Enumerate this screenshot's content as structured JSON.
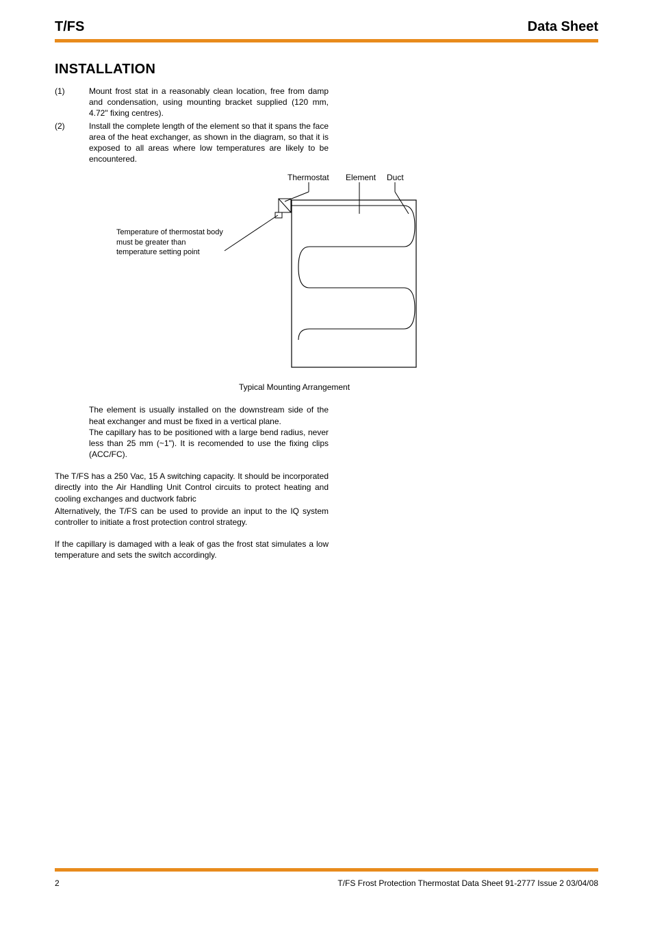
{
  "header": {
    "left": "T/FS",
    "right": "Data Sheet"
  },
  "section_heading": "INSTALLATION",
  "steps": [
    {
      "num": "(1)",
      "text": "Mount frost stat in a reasonably clean location, free from damp and condensation, using mounting bracket supplied (120 mm, 4.72\" fixing centres)."
    },
    {
      "num": "(2)",
      "text": "Install the complete length of the element so that it spans the face area of the heat exchanger, as shown in the diagram, so that it is exposed to all areas where low temperatures are likely to be encountered."
    }
  ],
  "diagram": {
    "label_thermostat": "Thermostat",
    "label_element": "Element",
    "label_duct": "Duct",
    "note_line1": "Temperature of thermostat body",
    "note_line2": "must be greater than",
    "note_line3": "temperature setting point",
    "caption": "Typical Mounting Arrangement"
  },
  "indent_paragraphs": [
    "The element is usually installed on the downstream side of the heat exchanger and must be fixed in a vertical plane.",
    "The capillary has to be positioned with a large bend radius, never less than 25 mm (~1\"). It is recomended to use the fixing clips (ACC/FC)."
  ],
  "body_paragraphs": [
    "The T/FS has a 250 Vac, 15 A switching capacity. It should be incorporated directly into the Air Handling Unit Control circuits to protect heating and cooling exchanges and ductwork fabric",
    "Alternatively, the T/FS can be used to provide an input to the IQ system controller to initiate a frost protection control strategy.",
    "If the capillary is damaged with a leak of gas the frost stat simulates a low temperature and sets the switch accordingly."
  ],
  "footer": {
    "page_num": "2",
    "doc_ref": "T/FS Frost Protection Thermostat Data Sheet 91-2777 Issue 2 03/04/08"
  }
}
